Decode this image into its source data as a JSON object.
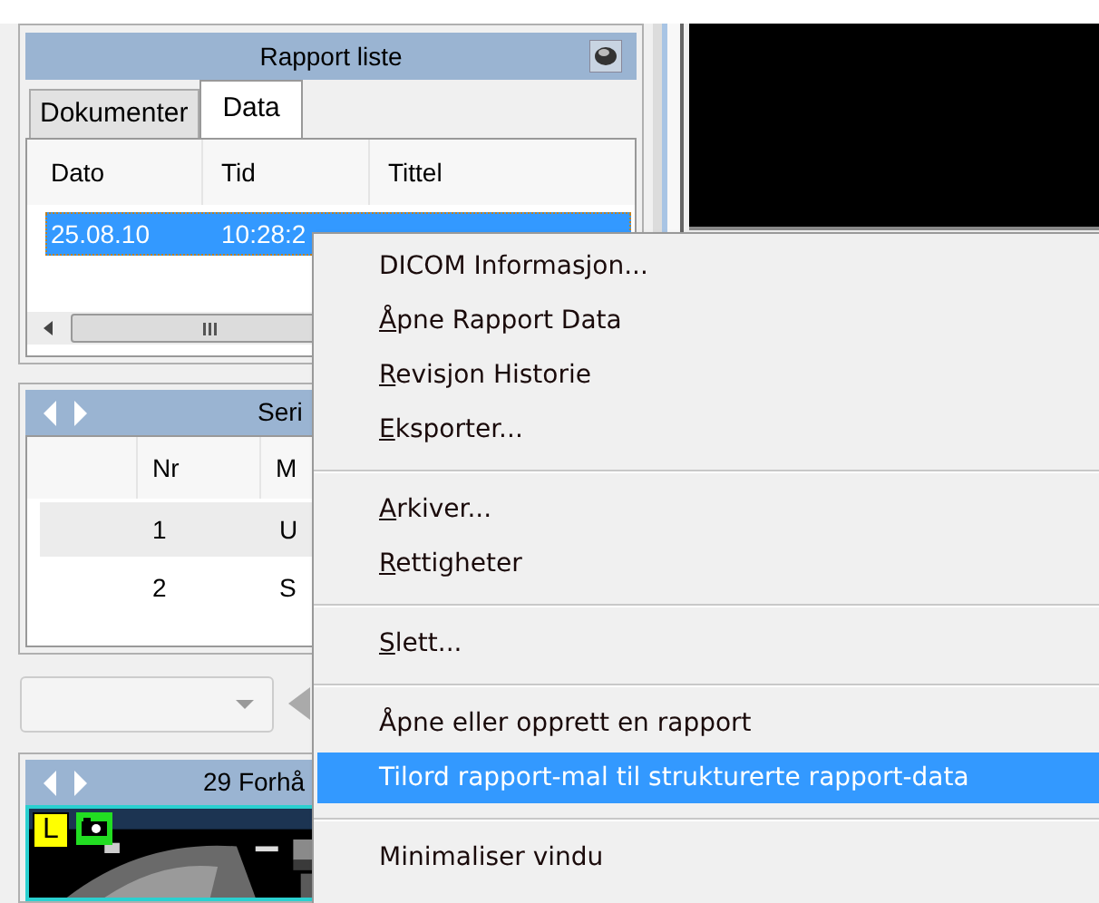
{
  "report_panel": {
    "title": "Rapport liste",
    "tabs": [
      {
        "label": "Dokumenter",
        "selected": false
      },
      {
        "label": "Data",
        "selected": true
      }
    ],
    "columns": [
      "Dato",
      "Tid",
      "Tittel"
    ],
    "rows": [
      {
        "cells": [
          "25.08.10",
          "10:28:2"
        ],
        "selected": true
      }
    ]
  },
  "series_panel": {
    "title": "Seri",
    "columns": [
      "Nr",
      "M"
    ],
    "rows": [
      {
        "cells": [
          "1",
          "U"
        ],
        "selected": true
      },
      {
        "cells": [
          "2",
          "S"
        ],
        "selected": false
      }
    ]
  },
  "image_panel": {
    "title": "29 Forhå",
    "badge": "L"
  },
  "context_menu": {
    "items": [
      {
        "kind": "item",
        "label": "DICOM Informasjon...",
        "underline_first": false,
        "selected": false
      },
      {
        "kind": "item",
        "label": "Åpne Rapport Data",
        "underline_first": true,
        "selected": false
      },
      {
        "kind": "item",
        "label": "Revisjon Historie",
        "underline_first": true,
        "selected": false
      },
      {
        "kind": "item",
        "label": "Eksporter...",
        "underline_first": true,
        "selected": false
      },
      {
        "kind": "separator"
      },
      {
        "kind": "item",
        "label": "Arkiver...",
        "underline_first": true,
        "selected": false
      },
      {
        "kind": "item",
        "label": "Rettigheter",
        "underline_first": true,
        "selected": false
      },
      {
        "kind": "separator"
      },
      {
        "kind": "item",
        "label": "Slett...",
        "underline_first": true,
        "selected": false
      },
      {
        "kind": "separator"
      },
      {
        "kind": "item",
        "label": "Åpne eller opprett en rapport",
        "underline_first": false,
        "selected": false
      },
      {
        "kind": "item",
        "label": "Tilord rapport-mal til strukturerte rapport-data",
        "underline_first": false,
        "selected": true
      },
      {
        "kind": "separator"
      },
      {
        "kind": "item",
        "label": "Minimaliser vindu",
        "underline_first": false,
        "selected": false
      }
    ]
  }
}
